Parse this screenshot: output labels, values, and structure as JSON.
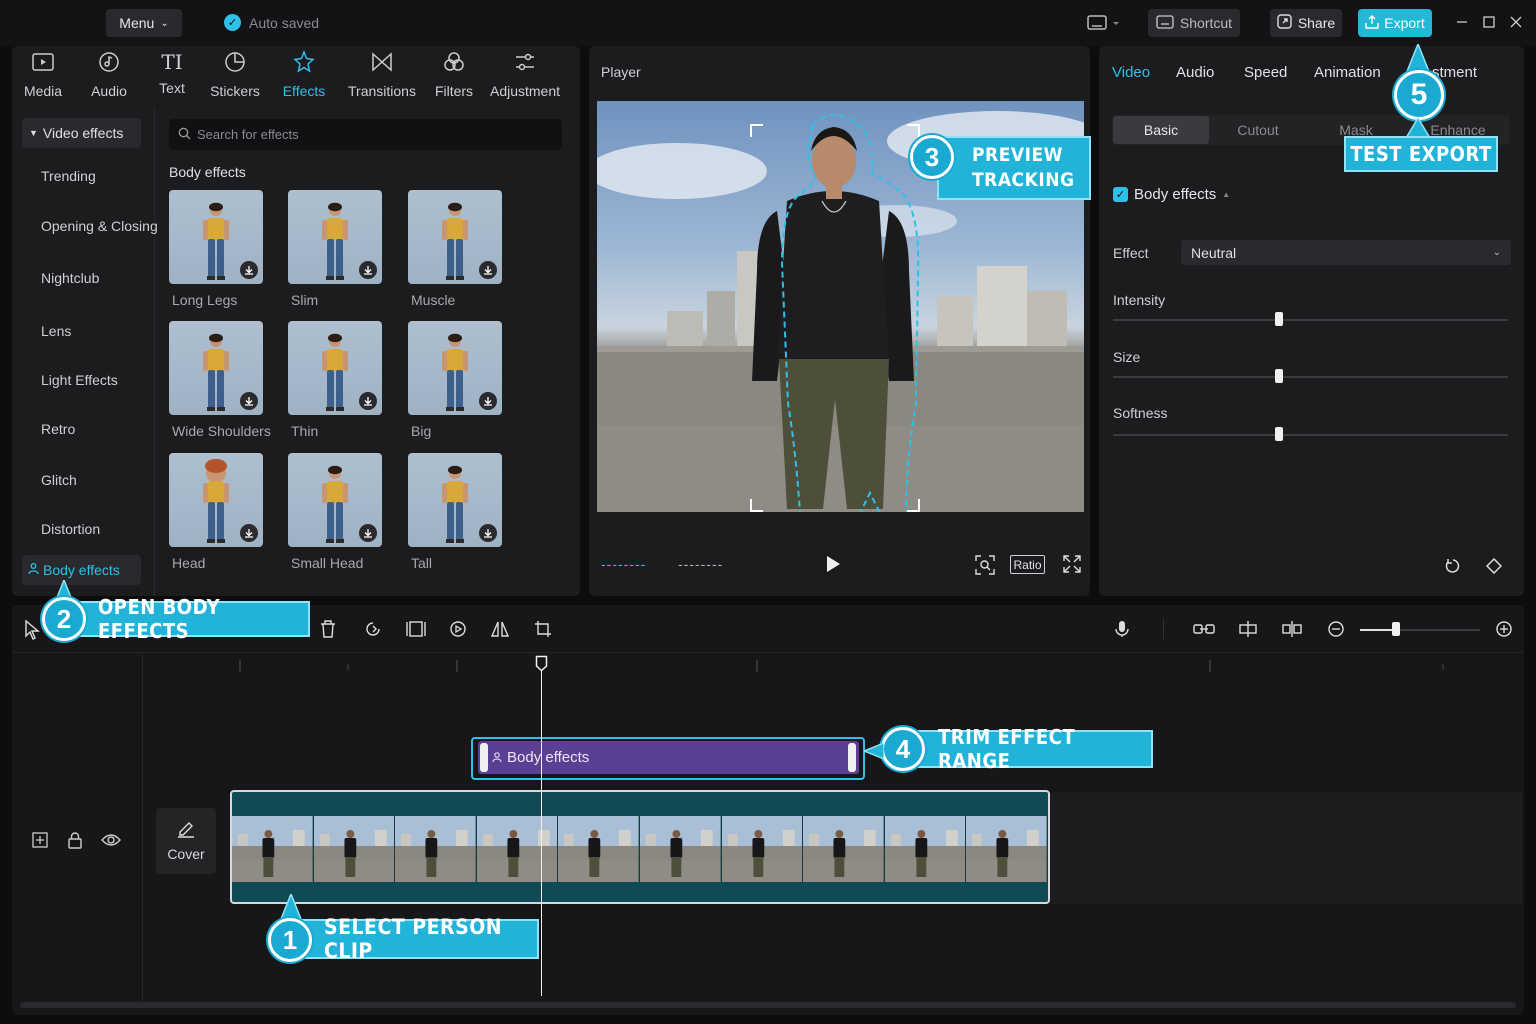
{
  "topbar": {
    "menu_label": "Menu",
    "autosave_label": "Auto saved",
    "shortcut_label": "Shortcut",
    "share_label": "Share",
    "export_label": "Export"
  },
  "tool_tabs": [
    {
      "label": "Media",
      "icon": "media-icon"
    },
    {
      "label": "Audio",
      "icon": "audio-icon"
    },
    {
      "label": "Text",
      "icon": "text-icon"
    },
    {
      "label": "Stickers",
      "icon": "stickers-icon"
    },
    {
      "label": "Effects",
      "icon": "effects-icon",
      "active": true
    },
    {
      "label": "Transitions",
      "icon": "transitions-icon"
    },
    {
      "label": "Filters",
      "icon": "filters-icon"
    },
    {
      "label": "Adjustment",
      "icon": "adjustment-icon"
    }
  ],
  "effects_panel": {
    "category_header": "Video effects",
    "categories": [
      "Trending",
      "Opening & Closing",
      "Nightclub",
      "Lens",
      "Light Effects",
      "Retro",
      "Glitch",
      "Distortion"
    ],
    "active_category": "Body effects",
    "search_placeholder": "Search for effects",
    "section_title": "Body effects",
    "items": [
      "Long Legs",
      "Slim",
      "Muscle",
      "Wide Shoulders",
      "Thin",
      "Big",
      "Head",
      "Small Head",
      "Tall"
    ]
  },
  "player": {
    "title": "Player",
    "time_current": "--------",
    "time_total": "--------",
    "ratio_label": "Ratio"
  },
  "properties": {
    "tabs": [
      "Video",
      "Audio",
      "Speed",
      "Animation",
      "stment"
    ],
    "subtabs": [
      "Basic",
      "Cutout",
      "Mask",
      "Enhance"
    ],
    "section_label": "Body effects",
    "effect_label": "Effect",
    "effect_value": "Neutral",
    "sliders": [
      {
        "label": "Intensity",
        "value": 0.42
      },
      {
        "label": "Size",
        "value": 0.42
      },
      {
        "label": "Softness",
        "value": 0.42
      }
    ]
  },
  "timeline": {
    "effect_clip_label": "Body effects",
    "cover_label": "Cover",
    "zoom_level": 0.3
  },
  "callouts": [
    {
      "num": "1",
      "text": "SELECT PERSON CLIP"
    },
    {
      "num": "2",
      "text": "OPEN BODY EFFECTS"
    },
    {
      "num": "3",
      "text": "PREVIEW TRACKING",
      "line1": "PREVIEW",
      "line2": "TRACKING"
    },
    {
      "num": "4",
      "text": "TRIM EFFECT RANGE"
    },
    {
      "num": "5",
      "text": "TEST EXPORT"
    }
  ],
  "colors": {
    "accent": "#2fc0e8",
    "callout": "#21b4d8",
    "effect_clip": "#5b3f95",
    "video_track": "#0f4a55"
  }
}
